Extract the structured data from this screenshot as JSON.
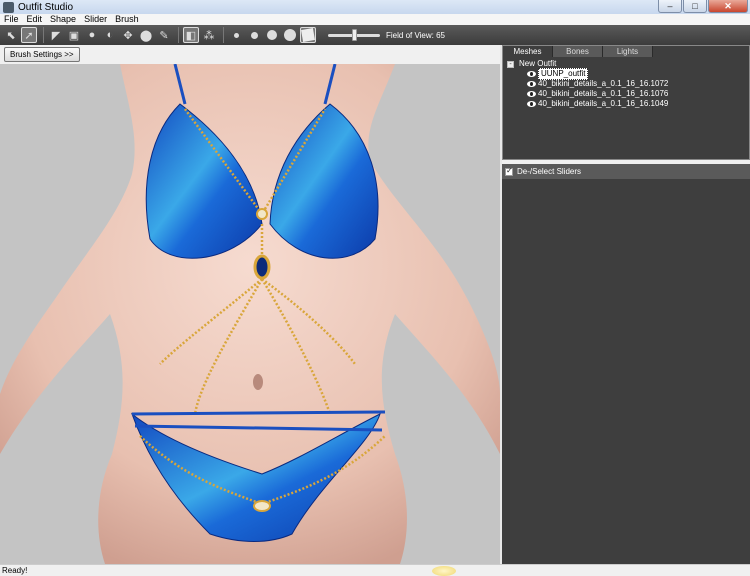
{
  "window": {
    "title": "Outfit Studio",
    "controls": {
      "minimize": "–",
      "maximize": "□",
      "close": "✕"
    }
  },
  "menu": [
    "File",
    "Edit",
    "Shape",
    "Slider",
    "Brush"
  ],
  "toolbar": {
    "fov_label": "Field of View: 65",
    "fov_value": 65
  },
  "viewport": {
    "brush_settings_label": "Brush Settings >>"
  },
  "panel": {
    "tabs": [
      "Meshes",
      "Bones",
      "Lights"
    ],
    "active_tab": "Meshes",
    "tree": {
      "root": "New Outfit",
      "expander": "-",
      "items": [
        "UUNP_outfit",
        "40_bikini_details_a_0.1_16_16.1072",
        "40_bikini_details_a_0.1_16_16.1076",
        "40_bikini_details_a_0.1_16_16.1049"
      ],
      "selected_index": 0
    }
  },
  "sliders": {
    "header_label": "De-/Select Sliders",
    "checked": true
  },
  "status": {
    "text": "Ready!"
  },
  "colors": {
    "toolbar_bg": "#4a4a4a",
    "panel_bg": "#3e3e3e",
    "viewport_bg": "#c4c4c4",
    "bikini": "#1f62c8",
    "chain": "#d9a63a",
    "skin": "#f0cfc2"
  }
}
